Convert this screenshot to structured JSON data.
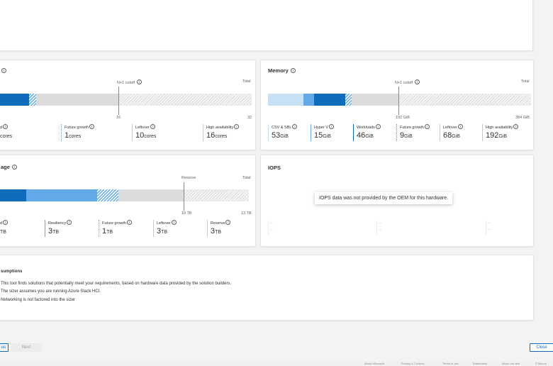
{
  "compute": {
    "title": "",
    "markers": {
      "n1_label": "N+1 cutoff",
      "total_label": "Total",
      "n1_value": "16",
      "total_value": "32"
    },
    "legend": [
      {
        "label": "d",
        "value": "cores",
        "unit": "",
        "color": "#0f6cbd"
      },
      {
        "label": "Future growth",
        "value": "1",
        "unit": "cores",
        "color": "#62a9e8"
      },
      {
        "label": "Leftover",
        "value": "10",
        "unit": "cores",
        "color": "#c8c8c8"
      },
      {
        "label": "High availability",
        "value": "16",
        "unit": "cores",
        "color": "#c8c8c8"
      }
    ]
  },
  "memory": {
    "title": "Memory",
    "markers": {
      "n1_label": "N+1 cutoff",
      "total_label": "Total",
      "n1_value": "192 GiB",
      "total_value": "384 GiB"
    },
    "legend": [
      {
        "label": "CSV & SBL",
        "value": "53",
        "unit": "GiB",
        "color": "#c7e0f4"
      },
      {
        "label": "Hyper V",
        "value": "15",
        "unit": "GiB",
        "color": "#62a9e8"
      },
      {
        "label": "Workloads",
        "value": "46",
        "unit": "GiB",
        "color": "#0f6cbd"
      },
      {
        "label": "Future growth",
        "value": "9",
        "unit": "GiB",
        "color": "#62a9e8"
      },
      {
        "label": "Leftover",
        "value": "68",
        "unit": "GiB",
        "color": "#c8c8c8"
      },
      {
        "label": "High availability",
        "value": "192",
        "unit": "GiB",
        "color": "#c8c8c8"
      }
    ]
  },
  "storage": {
    "title": "age",
    "markers": {
      "reserve_label": "Reserve",
      "total_label": "Total",
      "reserve_value": "10 TB",
      "total_value": "13 TB"
    },
    "legend": [
      {
        "label": "d",
        "value": "",
        "unit": "TB",
        "color": "#0f6cbd"
      },
      {
        "label": "Resiliency",
        "value": "3",
        "unit": "TB",
        "color": "#62a9e8"
      },
      {
        "label": "Future growth",
        "value": "1",
        "unit": "TB",
        "color": "#62a9e8"
      },
      {
        "label": "Leftover",
        "value": "3",
        "unit": "TB",
        "color": "#c8c8c8"
      },
      {
        "label": "Reserve",
        "value": "3",
        "unit": "TB",
        "color": "#c8c8c8"
      }
    ]
  },
  "iops": {
    "title": "IOPS",
    "message": "IOPS data was not provided by the OEM for this hardware.",
    "placeholder": "--"
  },
  "assumptions": {
    "title": "sumptions",
    "items": [
      "This tool finds solutions that potentially meet your requirements, based on hardware data provided by the solution builders.",
      "The sizer assumes you are running Azure Stack HCI.",
      "Networking is not factored into the sizer"
    ]
  },
  "buttons": {
    "back": "us",
    "next": "Next",
    "close": "Close"
  },
  "footer": [
    "About Microsoft",
    "Privacy & Cookies",
    "Terms of use",
    "Trademarks",
    "About our ads",
    "© Micros"
  ],
  "colors": {
    "primary": "#0f6cbd",
    "secondary": "#62a9e8",
    "light": "#c7e0f4",
    "neutral": "#dcdcdc"
  }
}
